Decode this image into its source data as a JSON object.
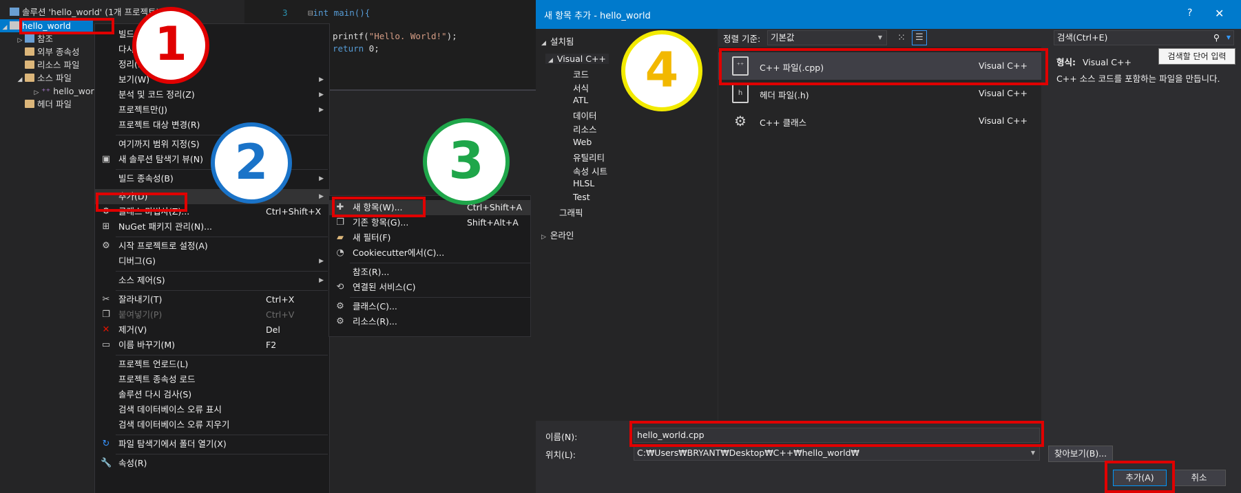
{
  "solution_tree": {
    "solution_label": "솔루션 'hello_world' (1개 프로젝트)",
    "project": "hello_world",
    "items": [
      {
        "label": "참조"
      },
      {
        "label": "외부 종속성"
      },
      {
        "label": "리소스 파일"
      },
      {
        "label": "소스 파일"
      },
      {
        "label": "hello_world.cpp"
      },
      {
        "label": "헤더 파일"
      }
    ]
  },
  "code_editor": {
    "line_number": "3",
    "line1": "int main(){",
    "line2_fn": "printf(",
    "line2_str": "\"Hello. World!\"",
    "line2_end": ");",
    "line3_kw": "return",
    "line3_end": " 0;"
  },
  "context_menu": {
    "items": [
      {
        "label": "빌드(U)"
      },
      {
        "label": "다시 빌드(E)"
      },
      {
        "label": "정리(N)"
      },
      {
        "label": "보기(W)"
      },
      {
        "label": "분석 및 코드 정리(Z)"
      },
      {
        "label": "프로젝트만(J)"
      },
      {
        "label": "프로젝트 대상 변경(R)"
      },
      {
        "label": "여기까지 범위 지정(S)"
      },
      {
        "label": "새 솔루션 탐색기 뷰(N)"
      },
      {
        "label": "빌드 종속성(B)"
      },
      {
        "label": "추가(D)"
      },
      {
        "label": "클래스 마법사(Z)...",
        "shortcut": "Ctrl+Shift+X"
      },
      {
        "label": "NuGet 패키지 관리(N)..."
      },
      {
        "label": "시작 프로젝트로 설정(A)"
      },
      {
        "label": "디버그(G)"
      },
      {
        "label": "소스 제어(S)"
      },
      {
        "label": "잘라내기(T)",
        "shortcut": "Ctrl+X"
      },
      {
        "label": "붙여넣기(P)",
        "shortcut": "Ctrl+V"
      },
      {
        "label": "제거(V)",
        "shortcut": "Del"
      },
      {
        "label": "이름 바꾸기(M)",
        "shortcut": "F2"
      },
      {
        "label": "프로젝트 언로드(L)"
      },
      {
        "label": "프로젝트 종속성 로드"
      },
      {
        "label": "솔루션 다시 검사(S)"
      },
      {
        "label": "검색 데이터베이스 오류 표시"
      },
      {
        "label": "검색 데이터베이스 오류 지우기"
      },
      {
        "label": "파일 탐색기에서 폴더 열기(X)"
      },
      {
        "label": "속성(R)"
      }
    ]
  },
  "add_submenu": {
    "items": [
      {
        "label": "새 항목(W)...",
        "shortcut": "Ctrl+Shift+A"
      },
      {
        "label": "기존 항목(G)...",
        "shortcut": "Shift+Alt+A"
      },
      {
        "label": "새 필터(F)"
      },
      {
        "label": "Cookiecutter에서(C)..."
      },
      {
        "label": "참조(R)..."
      },
      {
        "label": "연결된 서비스(C)"
      },
      {
        "label": "클래스(C)..."
      },
      {
        "label": "리소스(R)..."
      }
    ]
  },
  "badges": {
    "b1": "1",
    "b2": "2",
    "b3": "3",
    "b4": "4",
    "colors": {
      "b1": "#e00000",
      "b2": "#1a73c8",
      "b3": "#1fa64a",
      "b4": "#f2b800"
    }
  },
  "dialog": {
    "title": "새 항목 추가 - hello_world",
    "help": "?",
    "close": "✕",
    "installed": "설치됨",
    "visual_cpp": "Visual C++",
    "categories": [
      "코드",
      "서식",
      "ATL",
      "데이터",
      "리소스",
      "Web",
      "유틸리티",
      "속성 시트",
      "HLSL",
      "Test"
    ],
    "graphics": "그래픽",
    "online": "온라인",
    "sort_label": "정렬 기준:",
    "sort_value": "기본값",
    "search_placeholder": "검색(Ctrl+E)",
    "search_tooltip": "검색할 단어 입력",
    "templates": [
      {
        "name": "C++ 파일(.cpp)",
        "lang": "Visual C++"
      },
      {
        "name": "헤더 파일(.h)",
        "lang": "Visual C++"
      },
      {
        "name": "C++ 클래스",
        "lang": "Visual C++"
      }
    ],
    "type_label": "형식:",
    "type_value": "Visual C++",
    "description": "C++ 소스 코드를 포함하는 파일을 만듭니다.",
    "name_label": "이름(N):",
    "name_value": "hello_world.cpp",
    "location_label": "위치(L):",
    "location_value": "C:₩Users₩BRYANT₩Desktop₩C++₩hello_world₩",
    "browse": "찾아보기(B)...",
    "add": "추가(A)",
    "cancel": "취소"
  },
  "accent_red": "#e00000"
}
